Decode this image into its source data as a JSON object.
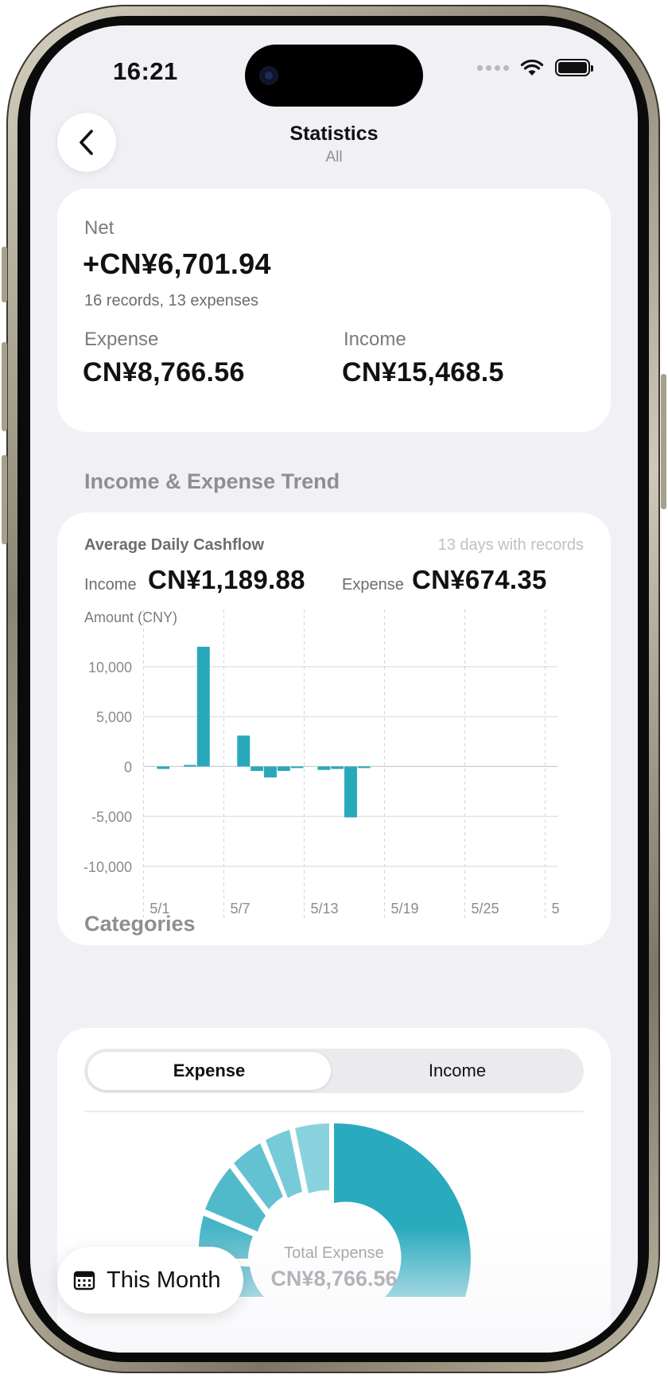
{
  "status_bar": {
    "time": "16:21"
  },
  "nav": {
    "title": "Statistics",
    "subtitle": "All"
  },
  "summary": {
    "net_label": "Net",
    "net_value": "+CN¥6,701.94",
    "records_text": "16 records, 13 expenses",
    "expense_label": "Expense",
    "expense_value": "CN¥8,766.56",
    "income_label": "Income",
    "income_value": "CN¥15,468.5"
  },
  "trend": {
    "section_title": "Income & Expense Trend",
    "avg_label": "Average Daily Cashflow",
    "days_text": "13 days with records",
    "income_label": "Income",
    "income_value": "CN¥1,189.88",
    "expense_label": "Expense",
    "expense_value": "CN¥674.35"
  },
  "chart_data": {
    "type": "bar",
    "ylabel": "Amount (CNY)",
    "ylim": [
      -12000,
      13500
    ],
    "yticks": [
      10000,
      5000,
      0,
      -5000,
      -10000
    ],
    "ytick_labels": [
      "10,000",
      "5,000",
      "0",
      "-5,000",
      "-10,000"
    ],
    "xlim": [
      0.5,
      31.5
    ],
    "xticks": [
      1,
      7,
      13,
      19,
      25,
      31
    ],
    "xtick_labels": [
      "5/1",
      "5/7",
      "5/13",
      "5/19",
      "5/25",
      "5"
    ],
    "days": [
      2,
      4,
      5,
      8,
      9,
      10,
      11,
      12,
      14,
      15,
      16,
      17
    ],
    "values": [
      -250,
      150,
      12000,
      3100,
      -450,
      -1100,
      -450,
      -50,
      -350,
      -250,
      -5100,
      -100
    ],
    "bar_color": "#2aa8bb",
    "grid": true
  },
  "categories": {
    "section_title": "Categories",
    "tab_expense": "Expense",
    "tab_income": "Income",
    "total_label": "Total Expense",
    "total_value": "CN¥8,766.56"
  },
  "month_button": {
    "label": "This Month",
    "icon": "calendar-icon"
  }
}
